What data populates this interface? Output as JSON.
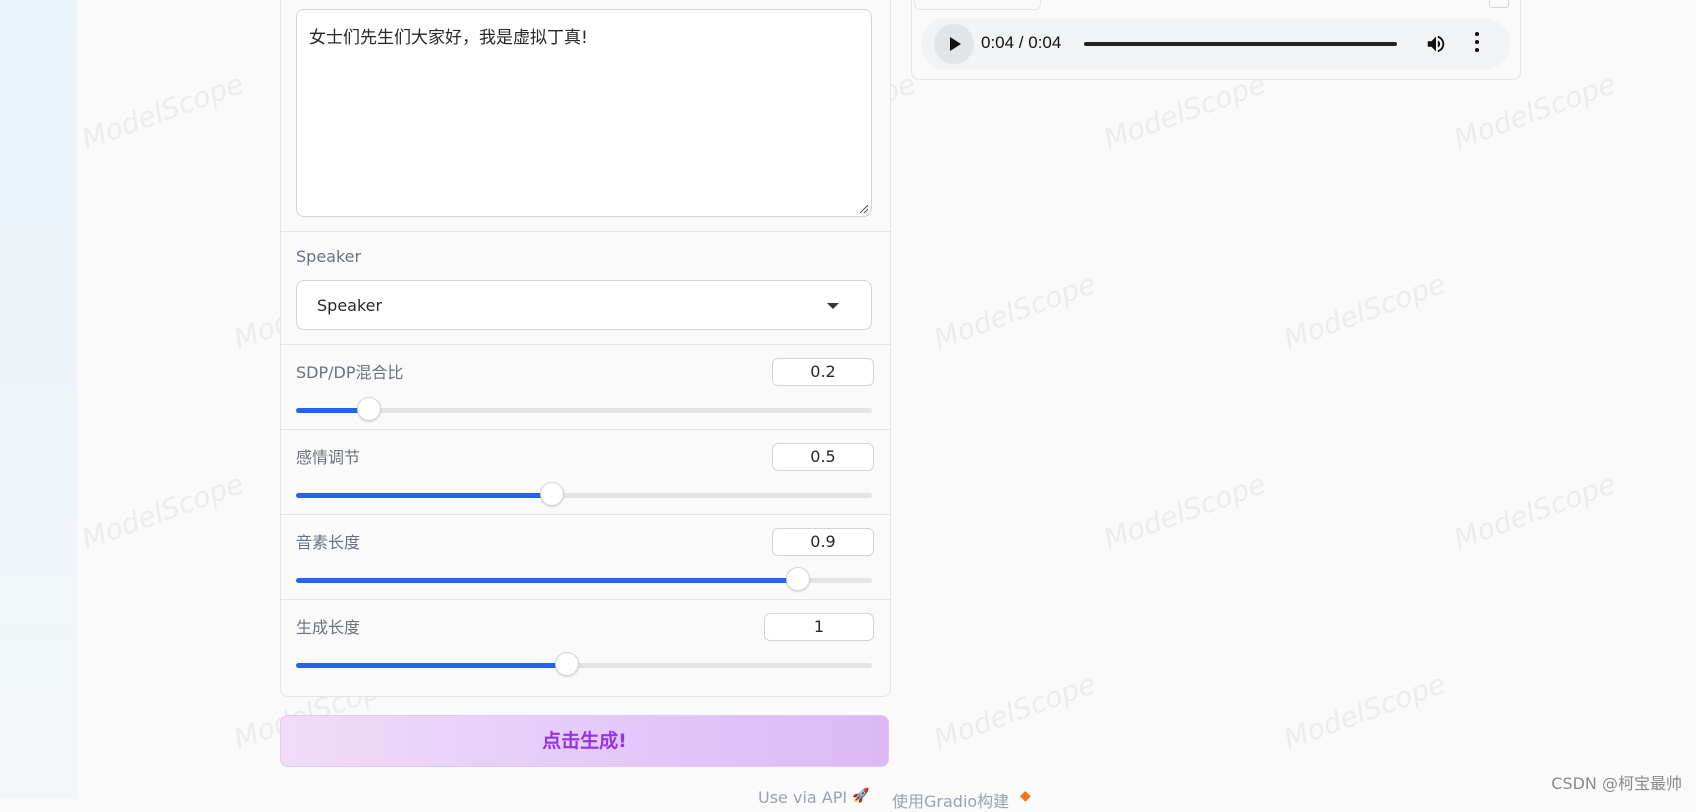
{
  "text_input": {
    "value": "女士们先生们大家好，我是虚拟丁真!"
  },
  "speaker": {
    "label": "Speaker",
    "selected": "Speaker"
  },
  "sliders": [
    {
      "label": "SDP/DP混合比",
      "value": "0.2",
      "fraction": 0.127
    },
    {
      "label": "感情调节",
      "value": "0.5",
      "fraction": 0.445
    },
    {
      "label": "音素长度",
      "value": "0.9",
      "fraction": 0.871
    },
    {
      "label": "生成长度",
      "value": "1",
      "fraction": 0.471
    }
  ],
  "generate_button": {
    "label": "点击生成!"
  },
  "audio": {
    "time": "0:04 / 0:04"
  },
  "footer": {
    "api_link": "Use via API",
    "built_with": "使用Gradio构建"
  },
  "watermark": "CSDN @柯宝最帅",
  "colors": {
    "accent": "#2563eb",
    "button_text": "#9333ea"
  },
  "icons": [
    "play-icon",
    "volume-icon",
    "more-options-icon",
    "dropdown-caret-icon",
    "rocket-icon",
    "gradio-logo-icon"
  ]
}
